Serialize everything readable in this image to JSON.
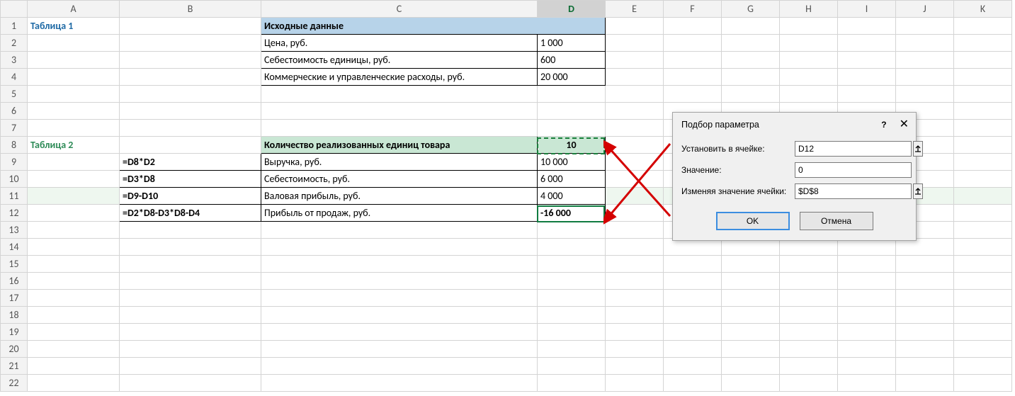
{
  "columns": [
    "A",
    "B",
    "C",
    "D",
    "E",
    "F",
    "G",
    "H",
    "I",
    "J",
    "K"
  ],
  "rows": 22,
  "selected_col": "D",
  "selected_row": 11,
  "table1": {
    "title": "Таблица 1",
    "header": "Исходные данные",
    "rows": [
      {
        "label": "Цена, руб.",
        "value": "1 000"
      },
      {
        "label": "Себестоимость единицы, руб.",
        "value": "600"
      },
      {
        "label": "Коммерческие и управленческие расходы, руб.",
        "value": "20 000"
      }
    ]
  },
  "table2": {
    "title": "Таблица 2",
    "header": "Количество реализованных единиц товара",
    "header_value": "10",
    "rows": [
      {
        "formula": "=D8*D2",
        "label": "Выручка, руб.",
        "value": "10 000"
      },
      {
        "formula": "=D3*D8",
        "label": "Себестоимость, руб.",
        "value": "6 000"
      },
      {
        "formula": "=D9-D10",
        "label": "Валовая прибыль, руб.",
        "value": "4 000"
      },
      {
        "formula": "=D2*D8-D3*D8-D4",
        "label": "Прибыль от продаж, руб.",
        "value": "-16 000"
      }
    ]
  },
  "dialog": {
    "title": "Подбор параметра",
    "help": "?",
    "close": "✕",
    "set_cell_label": "Установить в ячейке:",
    "set_cell_value": "D12",
    "value_label": "Значение:",
    "value_value": "0",
    "changing_label": "Изменяя значение ячейки:",
    "changing_value": "$D$8",
    "ok": "OK",
    "cancel": "Отмена"
  }
}
